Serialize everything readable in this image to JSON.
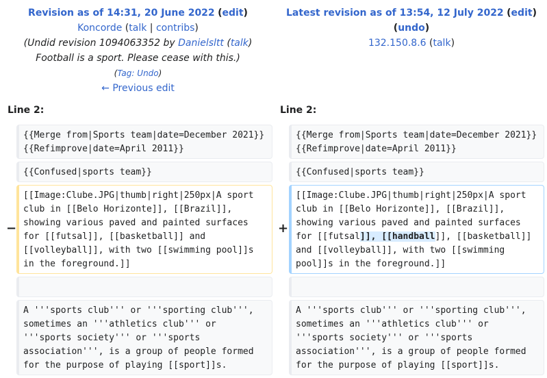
{
  "left_header": {
    "title_link": "Revision as of 14:31, 20 June 2022",
    "edit_link": "edit",
    "user_link": "Koncorde",
    "talk_link": "talk",
    "contribs_link": "contribs",
    "summary_prefix": "(Undid revision 1094063352 by ",
    "summary_user": "Danielsltt",
    "summary_talk": "talk",
    "summary_text": "Football is a sport. Please cease with this.)",
    "tag_label": "Tag:",
    "tag_link": "Undo",
    "prev_link": "← Previous edit"
  },
  "right_header": {
    "title_link": "Latest revision as of 13:54, 12 July 2022",
    "edit_link": "edit",
    "undo_link": "undo",
    "user_link": "132.150.8.6",
    "talk_link": "talk"
  },
  "diff": {
    "left_line_label": "Line 2:",
    "right_line_label": "Line 2:",
    "minus_marker": "−",
    "plus_marker": "+",
    "ctx1": "{{Merge from|Sports team|date=December 2021}}\n{{Refimprove|date=April 2011}}",
    "ctx2": "{{Confused|sports team}}",
    "removed": "[[Image:Clube.JPG|thumb|right|250px|A sport club in [[Belo Horizonte]], [[Brazil]], showing various paved and painted surfaces for [[futsal]], [[basketball]] and [[volleyball]], with two [[swimming pool]]s in the foreground.]]",
    "added_before": "[[Image:Clube.JPG|thumb|right|250px|A sport club in [[Belo Horizonte]], [[Brazil]], showing various paved and painted surfaces for [[futsal",
    "added_highlight": "]], [[handball",
    "added_after": "]], [[basketball]] and [[volleyball]], with two [[swimming pool]]s in the foreground.]]",
    "ctx3": "",
    "ctx4": "A '''sports club''' or '''sporting club''', sometimes an '''athletics club''' or '''sports society''' or '''sports association''', is a group of people formed for the purpose of playing [[sport]]s."
  },
  "colors": {
    "link": "#3366cc",
    "removed_border": "#ffe49c",
    "added_border": "#a3d3ff",
    "added_highlight": "#d8ecff",
    "context_bg": "#f8f9fa"
  }
}
